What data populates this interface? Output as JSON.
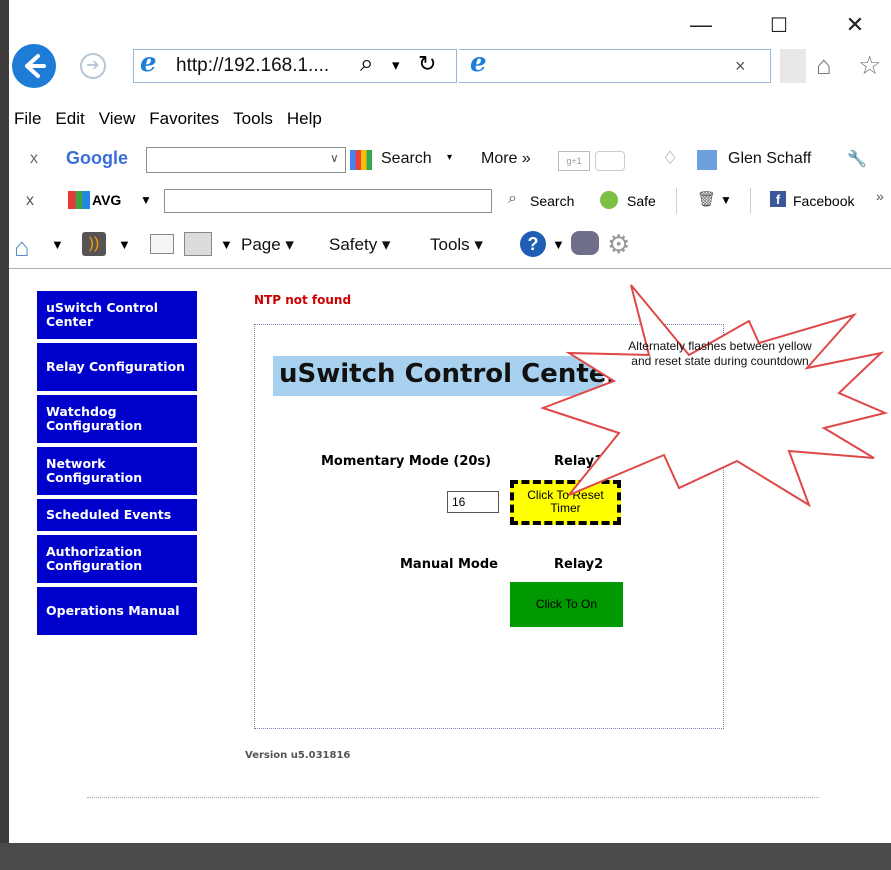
{
  "window": {
    "minimize": "—",
    "maximize": "☐",
    "close": "✕"
  },
  "address_bar": {
    "url": "http://192.168.1....",
    "search_glyph": "⌕",
    "dropdown_glyph": "▾",
    "refresh_glyph": "↻",
    "tab_close": "×"
  },
  "menubar": [
    "File",
    "Edit",
    "View",
    "Favorites",
    "Tools",
    "Help"
  ],
  "google_toolbar": {
    "close": "x",
    "brand": "Google",
    "search_label": "Search",
    "more_label": "More »",
    "user": "Glen Schaff"
  },
  "avg_toolbar": {
    "close": "x",
    "brand": "AVG",
    "search_label": "Search",
    "safe_label": "Safe",
    "facebook_label": "Facebook",
    "overflow": "»"
  },
  "command_bar": {
    "page_label": "Page",
    "safety_label": "Safety",
    "tools_label": "Tools"
  },
  "sidebar": {
    "items": [
      {
        "label": "uSwitch Control Center"
      },
      {
        "label": "Relay Configuration"
      },
      {
        "label": "Watchdog Configuration"
      },
      {
        "label": "Network Configuration"
      },
      {
        "label": "Scheduled Events"
      },
      {
        "label": "Authorization Configuration"
      },
      {
        "label": "Operations Manual"
      }
    ]
  },
  "main": {
    "ntp_status": "NTP not found",
    "title": "uSwitch Control Center",
    "momentary_label": "Momentary Mode (20s)",
    "relay1_label": "Relay1",
    "timer_value": "16",
    "reset_button": "Click To Reset Timer",
    "manual_label": "Manual Mode",
    "relay2_label": "Relay2",
    "on_button": "Click To On",
    "version": "Version u5.031816"
  },
  "callout": {
    "text": "Alternately flashes between yellow and reset state during countdown"
  },
  "colors": {
    "nav_bg": "#0000cc",
    "title_bg": "#a8d1ef",
    "reset_bg": "#ffff00",
    "on_bg": "#009900",
    "ntp_text": "#cc0000",
    "callout_stroke": "#e04848"
  }
}
